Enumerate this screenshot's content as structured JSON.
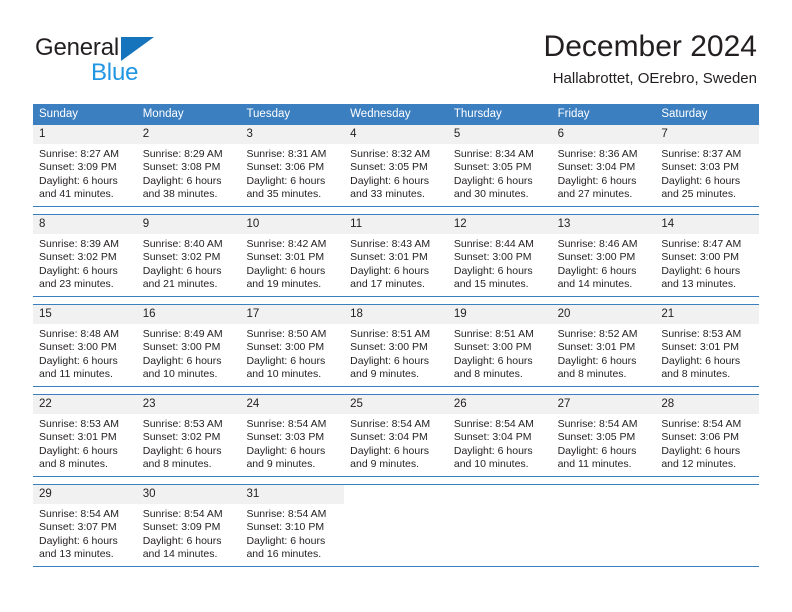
{
  "brand": {
    "name_part1": "General",
    "name_part2": "Blue",
    "triangle_color": "#1574bb",
    "blue_color": "#2196e3"
  },
  "header": {
    "title": "December 2024",
    "subtitle": "Hallabrottet, OErebro, Sweden"
  },
  "theme": {
    "header_blue": "#3c7fc1",
    "daynum_gray": "#f1f1f1",
    "text_color": "#231f20"
  },
  "weekdays": [
    "Sunday",
    "Monday",
    "Tuesday",
    "Wednesday",
    "Thursday",
    "Friday",
    "Saturday"
  ],
  "weeks": [
    [
      {
        "day": "1",
        "sunrise": "Sunrise: 8:27 AM",
        "sunset": "Sunset: 3:09 PM",
        "daylight1": "Daylight: 6 hours",
        "daylight2": "and 41 minutes."
      },
      {
        "day": "2",
        "sunrise": "Sunrise: 8:29 AM",
        "sunset": "Sunset: 3:08 PM",
        "daylight1": "Daylight: 6 hours",
        "daylight2": "and 38 minutes."
      },
      {
        "day": "3",
        "sunrise": "Sunrise: 8:31 AM",
        "sunset": "Sunset: 3:06 PM",
        "daylight1": "Daylight: 6 hours",
        "daylight2": "and 35 minutes."
      },
      {
        "day": "4",
        "sunrise": "Sunrise: 8:32 AM",
        "sunset": "Sunset: 3:05 PM",
        "daylight1": "Daylight: 6 hours",
        "daylight2": "and 33 minutes."
      },
      {
        "day": "5",
        "sunrise": "Sunrise: 8:34 AM",
        "sunset": "Sunset: 3:05 PM",
        "daylight1": "Daylight: 6 hours",
        "daylight2": "and 30 minutes."
      },
      {
        "day": "6",
        "sunrise": "Sunrise: 8:36 AM",
        "sunset": "Sunset: 3:04 PM",
        "daylight1": "Daylight: 6 hours",
        "daylight2": "and 27 minutes."
      },
      {
        "day": "7",
        "sunrise": "Sunrise: 8:37 AM",
        "sunset": "Sunset: 3:03 PM",
        "daylight1": "Daylight: 6 hours",
        "daylight2": "and 25 minutes."
      }
    ],
    [
      {
        "day": "8",
        "sunrise": "Sunrise: 8:39 AM",
        "sunset": "Sunset: 3:02 PM",
        "daylight1": "Daylight: 6 hours",
        "daylight2": "and 23 minutes."
      },
      {
        "day": "9",
        "sunrise": "Sunrise: 8:40 AM",
        "sunset": "Sunset: 3:02 PM",
        "daylight1": "Daylight: 6 hours",
        "daylight2": "and 21 minutes."
      },
      {
        "day": "10",
        "sunrise": "Sunrise: 8:42 AM",
        "sunset": "Sunset: 3:01 PM",
        "daylight1": "Daylight: 6 hours",
        "daylight2": "and 19 minutes."
      },
      {
        "day": "11",
        "sunrise": "Sunrise: 8:43 AM",
        "sunset": "Sunset: 3:01 PM",
        "daylight1": "Daylight: 6 hours",
        "daylight2": "and 17 minutes."
      },
      {
        "day": "12",
        "sunrise": "Sunrise: 8:44 AM",
        "sunset": "Sunset: 3:00 PM",
        "daylight1": "Daylight: 6 hours",
        "daylight2": "and 15 minutes."
      },
      {
        "day": "13",
        "sunrise": "Sunrise: 8:46 AM",
        "sunset": "Sunset: 3:00 PM",
        "daylight1": "Daylight: 6 hours",
        "daylight2": "and 14 minutes."
      },
      {
        "day": "14",
        "sunrise": "Sunrise: 8:47 AM",
        "sunset": "Sunset: 3:00 PM",
        "daylight1": "Daylight: 6 hours",
        "daylight2": "and 13 minutes."
      }
    ],
    [
      {
        "day": "15",
        "sunrise": "Sunrise: 8:48 AM",
        "sunset": "Sunset: 3:00 PM",
        "daylight1": "Daylight: 6 hours",
        "daylight2": "and 11 minutes."
      },
      {
        "day": "16",
        "sunrise": "Sunrise: 8:49 AM",
        "sunset": "Sunset: 3:00 PM",
        "daylight1": "Daylight: 6 hours",
        "daylight2": "and 10 minutes."
      },
      {
        "day": "17",
        "sunrise": "Sunrise: 8:50 AM",
        "sunset": "Sunset: 3:00 PM",
        "daylight1": "Daylight: 6 hours",
        "daylight2": "and 10 minutes."
      },
      {
        "day": "18",
        "sunrise": "Sunrise: 8:51 AM",
        "sunset": "Sunset: 3:00 PM",
        "daylight1": "Daylight: 6 hours",
        "daylight2": "and 9 minutes."
      },
      {
        "day": "19",
        "sunrise": "Sunrise: 8:51 AM",
        "sunset": "Sunset: 3:00 PM",
        "daylight1": "Daylight: 6 hours",
        "daylight2": "and 8 minutes."
      },
      {
        "day": "20",
        "sunrise": "Sunrise: 8:52 AM",
        "sunset": "Sunset: 3:01 PM",
        "daylight1": "Daylight: 6 hours",
        "daylight2": "and 8 minutes."
      },
      {
        "day": "21",
        "sunrise": "Sunrise: 8:53 AM",
        "sunset": "Sunset: 3:01 PM",
        "daylight1": "Daylight: 6 hours",
        "daylight2": "and 8 minutes."
      }
    ],
    [
      {
        "day": "22",
        "sunrise": "Sunrise: 8:53 AM",
        "sunset": "Sunset: 3:01 PM",
        "daylight1": "Daylight: 6 hours",
        "daylight2": "and 8 minutes."
      },
      {
        "day": "23",
        "sunrise": "Sunrise: 8:53 AM",
        "sunset": "Sunset: 3:02 PM",
        "daylight1": "Daylight: 6 hours",
        "daylight2": "and 8 minutes."
      },
      {
        "day": "24",
        "sunrise": "Sunrise: 8:54 AM",
        "sunset": "Sunset: 3:03 PM",
        "daylight1": "Daylight: 6 hours",
        "daylight2": "and 9 minutes."
      },
      {
        "day": "25",
        "sunrise": "Sunrise: 8:54 AM",
        "sunset": "Sunset: 3:04 PM",
        "daylight1": "Daylight: 6 hours",
        "daylight2": "and 9 minutes."
      },
      {
        "day": "26",
        "sunrise": "Sunrise: 8:54 AM",
        "sunset": "Sunset: 3:04 PM",
        "daylight1": "Daylight: 6 hours",
        "daylight2": "and 10 minutes."
      },
      {
        "day": "27",
        "sunrise": "Sunrise: 8:54 AM",
        "sunset": "Sunset: 3:05 PM",
        "daylight1": "Daylight: 6 hours",
        "daylight2": "and 11 minutes."
      },
      {
        "day": "28",
        "sunrise": "Sunrise: 8:54 AM",
        "sunset": "Sunset: 3:06 PM",
        "daylight1": "Daylight: 6 hours",
        "daylight2": "and 12 minutes."
      }
    ],
    [
      {
        "day": "29",
        "sunrise": "Sunrise: 8:54 AM",
        "sunset": "Sunset: 3:07 PM",
        "daylight1": "Daylight: 6 hours",
        "daylight2": "and 13 minutes."
      },
      {
        "day": "30",
        "sunrise": "Sunrise: 8:54 AM",
        "sunset": "Sunset: 3:09 PM",
        "daylight1": "Daylight: 6 hours",
        "daylight2": "and 14 minutes."
      },
      {
        "day": "31",
        "sunrise": "Sunrise: 8:54 AM",
        "sunset": "Sunset: 3:10 PM",
        "daylight1": "Daylight: 6 hours",
        "daylight2": "and 16 minutes."
      },
      {
        "day": "",
        "sunrise": "",
        "sunset": "",
        "daylight1": "",
        "daylight2": ""
      },
      {
        "day": "",
        "sunrise": "",
        "sunset": "",
        "daylight1": "",
        "daylight2": ""
      },
      {
        "day": "",
        "sunrise": "",
        "sunset": "",
        "daylight1": "",
        "daylight2": ""
      },
      {
        "day": "",
        "sunrise": "",
        "sunset": "",
        "daylight1": "",
        "daylight2": ""
      }
    ]
  ]
}
